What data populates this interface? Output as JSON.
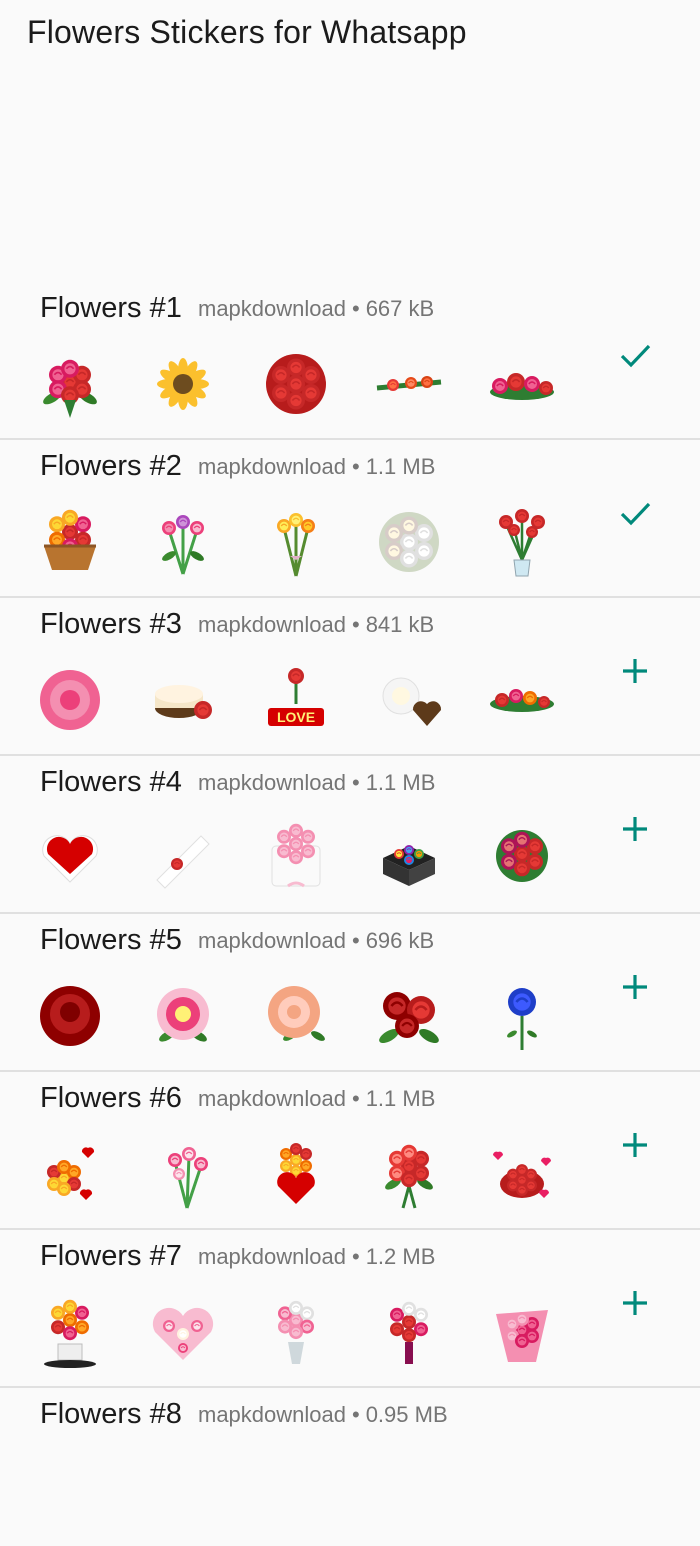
{
  "app": {
    "title": "Flowers Stickers for Whatsapp"
  },
  "colors": {
    "accent": "#00897b",
    "divider": "#e0e0e0",
    "meta": "#757575"
  },
  "packs": [
    {
      "name": "Flowers #1",
      "publisher": "mapkdownload",
      "size": "667 kB",
      "status": "added",
      "action_icon": "check-icon",
      "stickers": [
        "red-rose-bouquet",
        "sunflower",
        "red-rose-round-bouquet",
        "flower-stem-row",
        "pink-rose-spray"
      ]
    },
    {
      "name": "Flowers #2",
      "publisher": "mapkdownload",
      "size": "1.1 MB",
      "status": "added",
      "action_icon": "check-icon",
      "stickers": [
        "flower-basket",
        "tulip-bouquet",
        "yellow-tulip-bouquet",
        "white-rose-bouquet",
        "red-roses-vase"
      ]
    },
    {
      "name": "Flowers #3",
      "publisher": "mapkdownload",
      "size": "841 kB",
      "status": "not-added",
      "action_icon": "plus-icon",
      "stickers": [
        "pink-rose",
        "cake-with-rose",
        "love-tulip",
        "white-rose-with-chocolate",
        "mixed-flower-spray"
      ]
    },
    {
      "name": "Flowers #4",
      "publisher": "mapkdownload",
      "size": "1.1 MB",
      "status": "not-added",
      "action_icon": "plus-icon",
      "stickers": [
        "heart-rose-box",
        "single-rose-wrap",
        "pink-rose-hatbox",
        "rainbow-rose-box",
        "red-rose-dome"
      ]
    },
    {
      "name": "Flowers #5",
      "publisher": "mapkdownload",
      "size": "696 kB",
      "status": "not-added",
      "action_icon": "plus-icon",
      "stickers": [
        "dark-red-rose",
        "pink-yellow-rose",
        "peach-rose",
        "red-rose-trio",
        "blue-rose"
      ]
    },
    {
      "name": "Flowers #6",
      "publisher": "mapkdownload",
      "size": "1.1 MB",
      "status": "not-added",
      "action_icon": "plus-icon",
      "stickers": [
        "hearts-bouquet",
        "pink-tulip-bouquet",
        "heart-vase-bouquet",
        "red-rose-bunch",
        "hearts-rose-box"
      ]
    },
    {
      "name": "Flowers #7",
      "publisher": "mapkdownload",
      "size": "1.2 MB",
      "status": "not-added",
      "action_icon": "plus-icon",
      "stickers": [
        "mixed-vase-bouquet",
        "heart-wreath",
        "pastel-vase",
        "red-vase-bouquet",
        "pink-rose-wrap"
      ]
    },
    {
      "name": "Flowers #8",
      "publisher": "mapkdownload",
      "size": "0.95 MB",
      "status": "not-added",
      "action_icon": "plus-icon",
      "stickers": []
    }
  ]
}
